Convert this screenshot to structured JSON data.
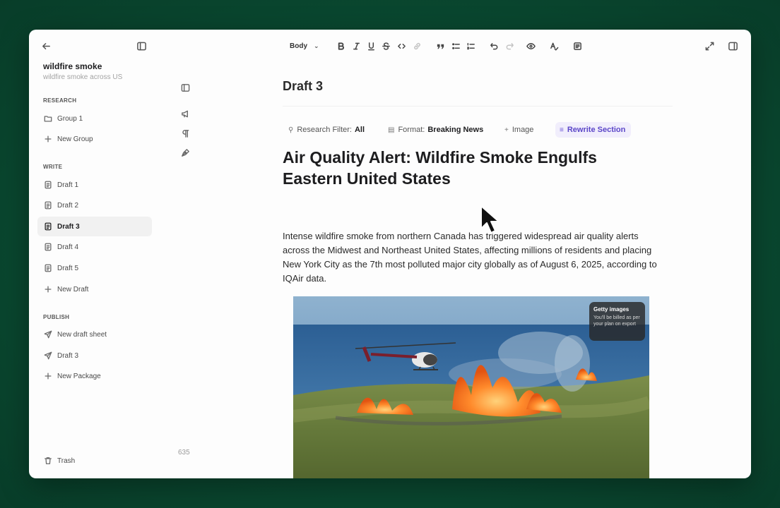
{
  "sidebar": {
    "project_title": "wildfire smoke",
    "project_subtitle": "wildfire smoke across US",
    "sections": {
      "research": "RESEARCH",
      "write": "WRITE",
      "publish": "PUBLISH"
    },
    "research_items": [
      {
        "label": "Group 1",
        "icon": "folder-icon"
      },
      {
        "label": "New Group",
        "icon": "plus-icon"
      }
    ],
    "write_items": [
      {
        "label": "Draft 1",
        "icon": "document-icon"
      },
      {
        "label": "Draft 2",
        "icon": "document-icon"
      },
      {
        "label": "Draft 3",
        "icon": "document-icon",
        "active": true
      },
      {
        "label": "Draft 4",
        "icon": "document-icon"
      },
      {
        "label": "Draft 5",
        "icon": "document-icon"
      },
      {
        "label": "New Draft",
        "icon": "plus-icon"
      }
    ],
    "publish_items": [
      {
        "label": "New draft sheet",
        "icon": "send-icon"
      },
      {
        "label": "Draft 3",
        "icon": "send-icon"
      },
      {
        "label": "New Package",
        "icon": "plus-icon"
      }
    ],
    "trash_label": "Trash"
  },
  "rail": {
    "word_count": "635"
  },
  "toolbar": {
    "text_style": "Body"
  },
  "editor": {
    "doc_title": "Draft 3",
    "chips": {
      "research_filter_label": "Research Filter:",
      "research_filter_value": "All",
      "format_label": "Format:",
      "format_value": "Breaking News",
      "image_label": "Image",
      "rewrite_label": "Rewrite Section"
    },
    "headline": "Air Quality Alert: Wildfire Smoke Engulfs Eastern United States",
    "paragraph": "Intense wildfire smoke from northern Canada has triggered widespread air quality alerts across the Midwest and Northeast United States, affecting millions of residents and placing New York City as the 7th most polluted major city globally as of August 6, 2025, according to IQAir data.",
    "image_overlay": {
      "title": "Getty images",
      "note": "You'll be billed as per your plan on export"
    }
  },
  "colors": {
    "background": "#0a4a31",
    "accent": "#5b46c8",
    "accent_bg": "#f1eefc"
  }
}
